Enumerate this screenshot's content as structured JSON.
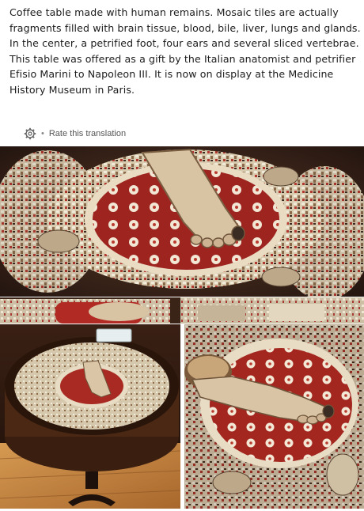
{
  "post": {
    "caption": "Coffee table made with human remains. Mosaic tiles are actually fragments filled with brain tissue, blood, bile, liver, lungs and glands. In the center, a petrified foot, four ears and several sliced vertebrae. This table was offered as a gift by the Italian anatomist and petrifier Efisio Marini to Napoleon III. It is now on display at the Medicine History Museum in Paris.",
    "translate_label": "Rate this translation",
    "separator": "•"
  },
  "images": [
    {
      "id": "top",
      "icon": "mosaic-foot-closeup"
    },
    {
      "id": "strip",
      "icon": "mosaic-strip"
    },
    {
      "id": "left",
      "icon": "table-full-view"
    },
    {
      "id": "right",
      "icon": "foot-closeup-angle"
    }
  ],
  "colors": {
    "mosaic_red": "#9e2420",
    "tile_cream": "#efe6d2",
    "background_dark": "#2a1a12",
    "wood": "#c98a45"
  }
}
